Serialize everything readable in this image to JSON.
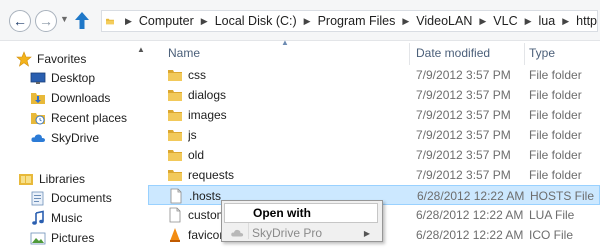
{
  "address": {
    "segments": [
      "Computer",
      "Local Disk (C:)",
      "Program Files",
      "VideoLAN",
      "VLC",
      "lua",
      "http"
    ]
  },
  "nav": {
    "favorites_header": "Favorites",
    "favorites": [
      {
        "label": "Desktop",
        "icon": "desktop-icon"
      },
      {
        "label": "Downloads",
        "icon": "downloads-icon"
      },
      {
        "label": "Recent places",
        "icon": "recent-places-icon"
      },
      {
        "label": "SkyDrive",
        "icon": "skydrive-icon"
      }
    ],
    "libraries_header": "Libraries",
    "libraries": [
      {
        "label": "Documents",
        "icon": "documents-icon"
      },
      {
        "label": "Music",
        "icon": "music-icon"
      },
      {
        "label": "Pictures",
        "icon": "pictures-icon"
      }
    ]
  },
  "columns": {
    "name": "Name",
    "date": "Date modified",
    "type": "Type"
  },
  "files": [
    {
      "name": "css",
      "date": "7/9/2012 3:57 PM",
      "type": "File folder",
      "icon": "folder-icon"
    },
    {
      "name": "dialogs",
      "date": "7/9/2012 3:57 PM",
      "type": "File folder",
      "icon": "folder-icon"
    },
    {
      "name": "images",
      "date": "7/9/2012 3:57 PM",
      "type": "File folder",
      "icon": "folder-icon"
    },
    {
      "name": "js",
      "date": "7/9/2012 3:57 PM",
      "type": "File folder",
      "icon": "folder-icon"
    },
    {
      "name": "old",
      "date": "7/9/2012 3:57 PM",
      "type": "File folder",
      "icon": "folder-icon"
    },
    {
      "name": "requests",
      "date": "7/9/2012 3:57 PM",
      "type": "File folder",
      "icon": "folder-icon"
    },
    {
      "name": ".hosts",
      "date": "6/28/2012 12:22 AM",
      "type": "HOSTS File",
      "icon": "file-icon",
      "selected": true
    },
    {
      "name": "custom",
      "date": "6/28/2012 12:22 AM",
      "type": "LUA File",
      "icon": "file-icon"
    },
    {
      "name": "favicon",
      "date": "6/28/2012 12:22 AM",
      "type": "ICO File",
      "icon": "vlc-icon"
    }
  ],
  "context_menu": {
    "items": [
      {
        "label": "Open with",
        "bold": true
      },
      {
        "label": "SkyDrive Pro",
        "disabled": true,
        "submenu": true
      }
    ]
  },
  "colors": {
    "selection": "#cce8ff",
    "selection_border": "#99d1ff",
    "header_text": "#4c607a"
  }
}
